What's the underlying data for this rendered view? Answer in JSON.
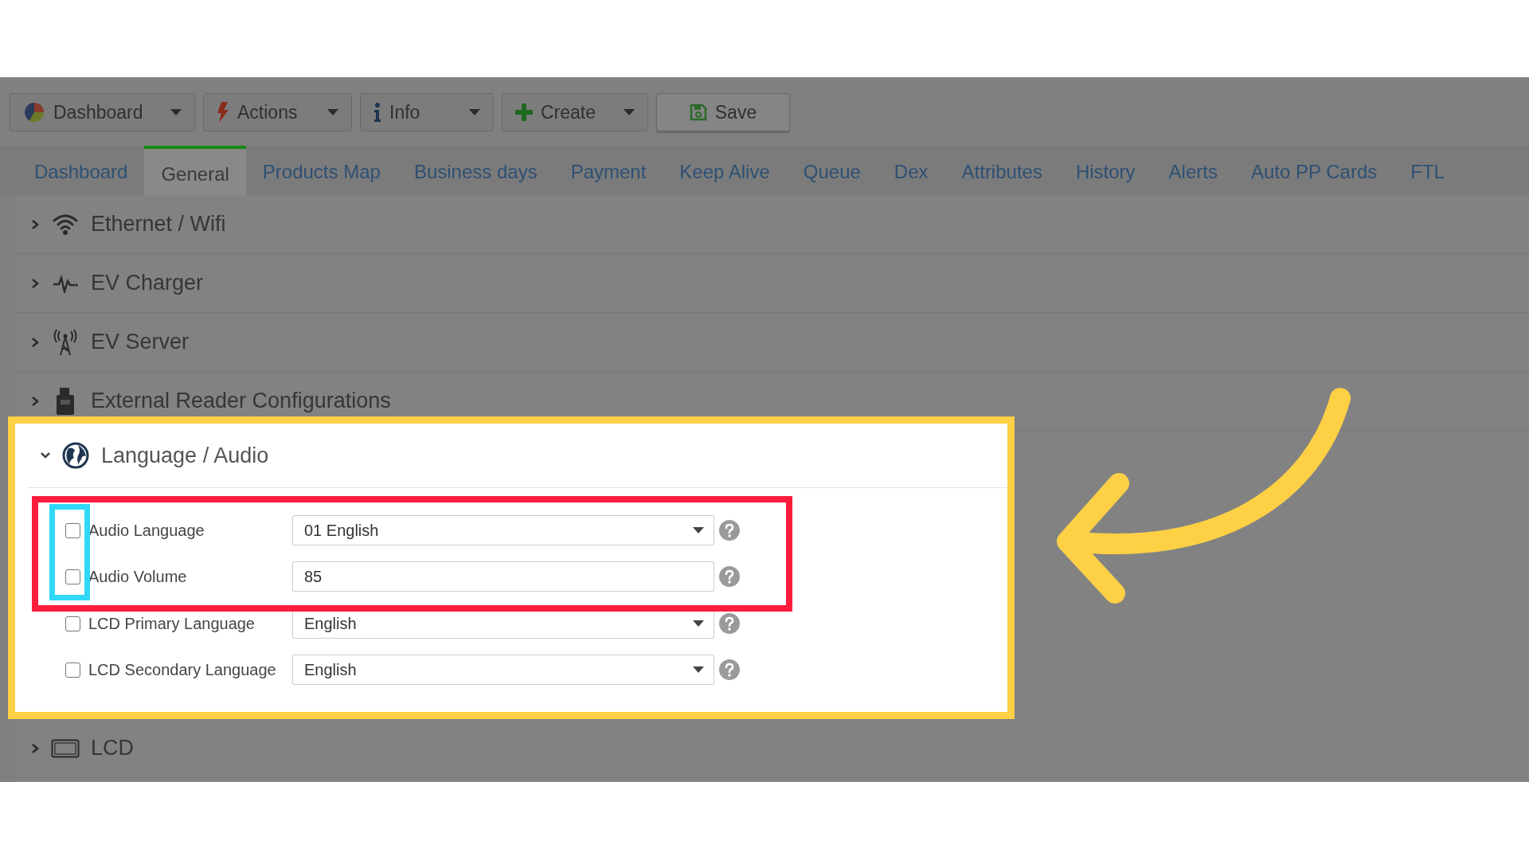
{
  "toolbar": [
    {
      "label": "Dashboard",
      "kind": "menu"
    },
    {
      "label": "Actions",
      "kind": "menu"
    },
    {
      "label": "Info",
      "kind": "menu"
    },
    {
      "label": "Create",
      "kind": "menu"
    },
    {
      "label": "Save",
      "kind": "button"
    }
  ],
  "tabs": [
    {
      "label": "Dashboard",
      "selected": false
    },
    {
      "label": "General",
      "selected": true
    },
    {
      "label": "Products Map",
      "selected": false
    },
    {
      "label": "Business days",
      "selected": false
    },
    {
      "label": "Payment",
      "selected": false
    },
    {
      "label": "Keep Alive",
      "selected": false
    },
    {
      "label": "Queue",
      "selected": false
    },
    {
      "label": "Dex",
      "selected": false
    },
    {
      "label": "Attributes",
      "selected": false
    },
    {
      "label": "History",
      "selected": false
    },
    {
      "label": "Alerts",
      "selected": false
    },
    {
      "label": "Auto PP Cards",
      "selected": false
    },
    {
      "label": "FTL",
      "selected": false
    }
  ],
  "sections": [
    {
      "title": "Ethernet / Wifi",
      "expanded": false,
      "highlighted": false
    },
    {
      "title": "EV Charger",
      "expanded": false,
      "highlighted": false
    },
    {
      "title": "EV Server",
      "expanded": false,
      "highlighted": false
    },
    {
      "title": "External Reader Configurations",
      "expanded": false,
      "highlighted": false
    },
    {
      "title": "Language / Audio",
      "expanded": true,
      "highlighted": true,
      "fields": [
        {
          "label": "Audio Language",
          "checked": false,
          "kind": "select",
          "value": "01 English",
          "marked": true
        },
        {
          "label": "Audio Volume",
          "checked": false,
          "kind": "text",
          "value": "85",
          "marked": true
        },
        {
          "label": "LCD Primary Language",
          "checked": false,
          "kind": "select",
          "value": "English",
          "marked": false
        },
        {
          "label": "LCD Secondary Language",
          "checked": false,
          "kind": "select",
          "value": "English",
          "marked": false
        }
      ]
    },
    {
      "title": "LCD",
      "expanded": false,
      "highlighted": false
    }
  ]
}
